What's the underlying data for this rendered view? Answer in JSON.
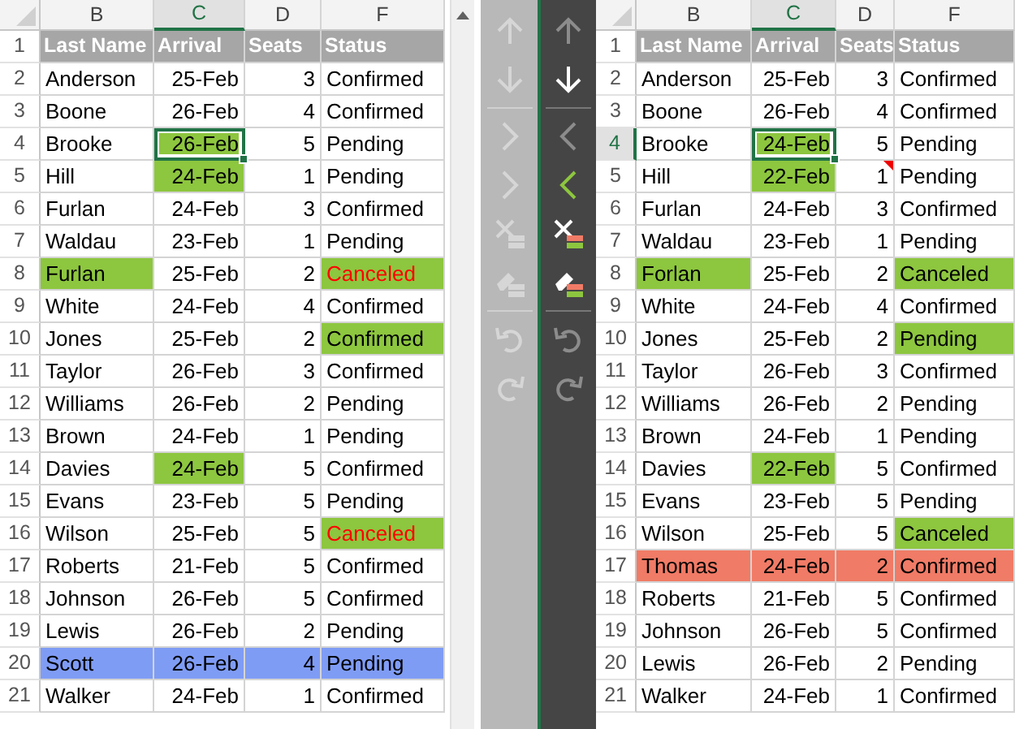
{
  "sheets": [
    {
      "columns": [
        {
          "letter": "B",
          "selected": false
        },
        {
          "letter": "C",
          "selected": true
        },
        {
          "letter": "D",
          "selected": false
        },
        {
          "letter": "F",
          "selected": false
        }
      ],
      "rows": [
        {
          "number": "1",
          "kind": "header",
          "selected": false,
          "cells": [
            {
              "text": "Last Name"
            },
            {
              "text": "Arrival"
            },
            {
              "text": "Seats"
            },
            {
              "text": "Status"
            }
          ]
        },
        {
          "number": "2",
          "selected": false,
          "cells": [
            {
              "text": "Anderson"
            },
            {
              "text": "25-Feb"
            },
            {
              "text": "3"
            },
            {
              "text": "Confirmed"
            }
          ]
        },
        {
          "number": "3",
          "selected": false,
          "cells": [
            {
              "text": "Boone"
            },
            {
              "text": "26-Feb"
            },
            {
              "text": "4"
            },
            {
              "text": "Confirmed"
            }
          ]
        },
        {
          "number": "4",
          "selected": false,
          "cells": [
            {
              "text": "Brooke"
            },
            {
              "text": "26-Feb",
              "color": "#8dc63f",
              "active": true
            },
            {
              "text": "5"
            },
            {
              "text": "Pending"
            }
          ]
        },
        {
          "number": "5",
          "selected": false,
          "cells": [
            {
              "text": "Hill"
            },
            {
              "text": "24-Feb",
              "color": "#8dc63f"
            },
            {
              "text": "1"
            },
            {
              "text": "Pending"
            }
          ]
        },
        {
          "number": "6",
          "selected": false,
          "cells": [
            {
              "text": "Furlan"
            },
            {
              "text": "24-Feb"
            },
            {
              "text": "3"
            },
            {
              "text": "Confirmed"
            }
          ]
        },
        {
          "number": "7",
          "selected": false,
          "cells": [
            {
              "text": "Waldau"
            },
            {
              "text": "23-Feb"
            },
            {
              "text": "1"
            },
            {
              "text": "Pending"
            }
          ]
        },
        {
          "number": "8",
          "selected": false,
          "cells": [
            {
              "text": "Furlan",
              "color": "#8dc63f"
            },
            {
              "text": "25-Feb"
            },
            {
              "text": "2"
            },
            {
              "text": "Canceled",
              "color": "#8dc63f",
              "alert": true
            }
          ]
        },
        {
          "number": "9",
          "selected": false,
          "cells": [
            {
              "text": "White"
            },
            {
              "text": "24-Feb"
            },
            {
              "text": "4"
            },
            {
              "text": "Confirmed"
            }
          ]
        },
        {
          "number": "10",
          "selected": false,
          "cells": [
            {
              "text": "Jones"
            },
            {
              "text": "25-Feb"
            },
            {
              "text": "2"
            },
            {
              "text": "Confirmed",
              "color": "#8dc63f"
            }
          ]
        },
        {
          "number": "11",
          "selected": false,
          "cells": [
            {
              "text": "Taylor"
            },
            {
              "text": "26-Feb"
            },
            {
              "text": "3"
            },
            {
              "text": "Confirmed"
            }
          ]
        },
        {
          "number": "12",
          "selected": false,
          "cells": [
            {
              "text": "Williams"
            },
            {
              "text": "26-Feb"
            },
            {
              "text": "2"
            },
            {
              "text": "Pending"
            }
          ]
        },
        {
          "number": "13",
          "selected": false,
          "cells": [
            {
              "text": "Brown"
            },
            {
              "text": "24-Feb"
            },
            {
              "text": "1"
            },
            {
              "text": "Pending"
            }
          ]
        },
        {
          "number": "14",
          "selected": false,
          "cells": [
            {
              "text": "Davies"
            },
            {
              "text": "24-Feb",
              "color": "#8dc63f"
            },
            {
              "text": "5"
            },
            {
              "text": "Confirmed"
            }
          ]
        },
        {
          "number": "15",
          "selected": false,
          "cells": [
            {
              "text": "Evans"
            },
            {
              "text": "23-Feb"
            },
            {
              "text": "5"
            },
            {
              "text": "Pending"
            }
          ]
        },
        {
          "number": "16",
          "selected": false,
          "cells": [
            {
              "text": "Wilson"
            },
            {
              "text": "25-Feb"
            },
            {
              "text": "5"
            },
            {
              "text": "Canceled",
              "color": "#8dc63f",
              "alert": true
            }
          ]
        },
        {
          "number": "17",
          "selected": false,
          "cells": [
            {
              "text": "Roberts"
            },
            {
              "text": "21-Feb"
            },
            {
              "text": "5"
            },
            {
              "text": "Confirmed"
            }
          ]
        },
        {
          "number": "18",
          "selected": false,
          "cells": [
            {
              "text": "Johnson"
            },
            {
              "text": "26-Feb"
            },
            {
              "text": "5"
            },
            {
              "text": "Confirmed"
            }
          ]
        },
        {
          "number": "19",
          "selected": false,
          "cells": [
            {
              "text": "Lewis"
            },
            {
              "text": "26-Feb"
            },
            {
              "text": "2"
            },
            {
              "text": "Pending"
            }
          ]
        },
        {
          "number": "20",
          "selected": false,
          "cells": [
            {
              "text": "Scott",
              "color": "#7f9cf5"
            },
            {
              "text": "26-Feb",
              "color": "#7f9cf5"
            },
            {
              "text": "4",
              "color": "#7f9cf5"
            },
            {
              "text": "Pending",
              "color": "#7f9cf5"
            }
          ]
        },
        {
          "number": "21",
          "selected": false,
          "cells": [
            {
              "text": "Walker"
            },
            {
              "text": "24-Feb"
            },
            {
              "text": "1"
            },
            {
              "text": "Confirmed"
            }
          ]
        }
      ]
    },
    {
      "columns": [
        {
          "letter": "B",
          "selected": false
        },
        {
          "letter": "C",
          "selected": true
        },
        {
          "letter": "D",
          "selected": false
        },
        {
          "letter": "F",
          "selected": false
        }
      ],
      "rows": [
        {
          "number": "1",
          "kind": "header",
          "selected": false,
          "cells": [
            {
              "text": "Last Name"
            },
            {
              "text": "Arrival"
            },
            {
              "text": "Seats"
            },
            {
              "text": "Status"
            }
          ]
        },
        {
          "number": "2",
          "selected": false,
          "cells": [
            {
              "text": "Anderson"
            },
            {
              "text": "25-Feb"
            },
            {
              "text": "3"
            },
            {
              "text": "Confirmed"
            }
          ]
        },
        {
          "number": "3",
          "selected": false,
          "cells": [
            {
              "text": "Boone"
            },
            {
              "text": "26-Feb"
            },
            {
              "text": "4"
            },
            {
              "text": "Confirmed"
            }
          ]
        },
        {
          "number": "4",
          "selected": true,
          "cells": [
            {
              "text": "Brooke"
            },
            {
              "text": "24-Feb",
              "color": "#8dc63f",
              "active": true
            },
            {
              "text": "5"
            },
            {
              "text": "Pending"
            }
          ]
        },
        {
          "number": "5",
          "selected": false,
          "cells": [
            {
              "text": "Hill"
            },
            {
              "text": "22-Feb",
              "color": "#8dc63f"
            },
            {
              "text": "1",
              "comment": true
            },
            {
              "text": "Pending"
            }
          ]
        },
        {
          "number": "6",
          "selected": false,
          "cells": [
            {
              "text": "Furlan"
            },
            {
              "text": "24-Feb"
            },
            {
              "text": "3"
            },
            {
              "text": "Confirmed"
            }
          ]
        },
        {
          "number": "7",
          "selected": false,
          "cells": [
            {
              "text": "Waldau"
            },
            {
              "text": "23-Feb"
            },
            {
              "text": "1"
            },
            {
              "text": "Pending"
            }
          ]
        },
        {
          "number": "8",
          "selected": false,
          "cells": [
            {
              "text": "Forlan",
              "color": "#8dc63f"
            },
            {
              "text": "25-Feb"
            },
            {
              "text": "2"
            },
            {
              "text": "Canceled",
              "color": "#8dc63f"
            }
          ]
        },
        {
          "number": "9",
          "selected": false,
          "cells": [
            {
              "text": "White"
            },
            {
              "text": "24-Feb"
            },
            {
              "text": "4"
            },
            {
              "text": "Confirmed"
            }
          ]
        },
        {
          "number": "10",
          "selected": false,
          "cells": [
            {
              "text": "Jones"
            },
            {
              "text": "25-Feb"
            },
            {
              "text": "2"
            },
            {
              "text": "Pending",
              "color": "#8dc63f"
            }
          ]
        },
        {
          "number": "11",
          "selected": false,
          "cells": [
            {
              "text": "Taylor"
            },
            {
              "text": "26-Feb"
            },
            {
              "text": "3"
            },
            {
              "text": "Confirmed"
            }
          ]
        },
        {
          "number": "12",
          "selected": false,
          "cells": [
            {
              "text": "Williams"
            },
            {
              "text": "26-Feb"
            },
            {
              "text": "2"
            },
            {
              "text": "Pending"
            }
          ]
        },
        {
          "number": "13",
          "selected": false,
          "cells": [
            {
              "text": "Brown"
            },
            {
              "text": "24-Feb"
            },
            {
              "text": "1"
            },
            {
              "text": "Pending"
            }
          ]
        },
        {
          "number": "14",
          "selected": false,
          "cells": [
            {
              "text": "Davies"
            },
            {
              "text": "22-Feb",
              "color": "#8dc63f"
            },
            {
              "text": "5"
            },
            {
              "text": "Confirmed"
            }
          ]
        },
        {
          "number": "15",
          "selected": false,
          "cells": [
            {
              "text": "Evans"
            },
            {
              "text": "23-Feb"
            },
            {
              "text": "5"
            },
            {
              "text": "Pending"
            }
          ]
        },
        {
          "number": "16",
          "selected": false,
          "cells": [
            {
              "text": "Wilson"
            },
            {
              "text": "25-Feb"
            },
            {
              "text": "5"
            },
            {
              "text": "Canceled",
              "color": "#8dc63f"
            }
          ]
        },
        {
          "number": "17",
          "selected": false,
          "cells": [
            {
              "text": "Thomas",
              "color": "#f07b66"
            },
            {
              "text": "24-Feb",
              "color": "#f07b66"
            },
            {
              "text": "2",
              "color": "#f07b66"
            },
            {
              "text": "Confirmed",
              "color": "#f07b66"
            }
          ]
        },
        {
          "number": "18",
          "selected": false,
          "cells": [
            {
              "text": "Roberts"
            },
            {
              "text": "21-Feb"
            },
            {
              "text": "5"
            },
            {
              "text": "Confirmed"
            }
          ]
        },
        {
          "number": "19",
          "selected": false,
          "cells": [
            {
              "text": "Johnson"
            },
            {
              "text": "26-Feb"
            },
            {
              "text": "5"
            },
            {
              "text": "Confirmed"
            }
          ]
        },
        {
          "number": "20",
          "selected": false,
          "cells": [
            {
              "text": "Lewis"
            },
            {
              "text": "26-Feb"
            },
            {
              "text": "2"
            },
            {
              "text": "Pending"
            }
          ]
        },
        {
          "number": "21",
          "selected": false,
          "cells": [
            {
              "text": "Walker"
            },
            {
              "text": "24-Feb"
            },
            {
              "text": "1"
            },
            {
              "text": "Confirmed"
            }
          ]
        }
      ]
    }
  ],
  "toolbars": [
    {
      "items": [
        {
          "kind": "arrow-up",
          "disabled": true,
          "highlighted": false
        },
        {
          "kind": "arrow-down",
          "disabled": true,
          "highlighted": false
        },
        {
          "kind": "separator"
        },
        {
          "kind": "chevron-right",
          "disabled": true,
          "highlighted": false
        },
        {
          "kind": "chevron-right",
          "disabled": true,
          "highlighted": false
        },
        {
          "kind": "clear",
          "disabled": true,
          "highlighted": false
        },
        {
          "kind": "eraser",
          "disabled": true,
          "highlighted": false
        },
        {
          "kind": "separator"
        },
        {
          "kind": "undo",
          "disabled": true,
          "highlighted": false
        },
        {
          "kind": "redo",
          "disabled": true,
          "highlighted": false
        }
      ]
    },
    {
      "items": [
        {
          "kind": "arrow-up",
          "disabled": true,
          "highlighted": false
        },
        {
          "kind": "arrow-down",
          "disabled": false,
          "highlighted": false
        },
        {
          "kind": "separator"
        },
        {
          "kind": "chevron-left",
          "disabled": true,
          "highlighted": false
        },
        {
          "kind": "chevron-left",
          "disabled": false,
          "highlighted": true
        },
        {
          "kind": "clear",
          "disabled": false,
          "highlighted": false
        },
        {
          "kind": "eraser",
          "disabled": false,
          "highlighted": false
        },
        {
          "kind": "separator"
        },
        {
          "kind": "undo",
          "disabled": true,
          "highlighted": false
        },
        {
          "kind": "redo",
          "disabled": true,
          "highlighted": false
        }
      ]
    }
  ]
}
